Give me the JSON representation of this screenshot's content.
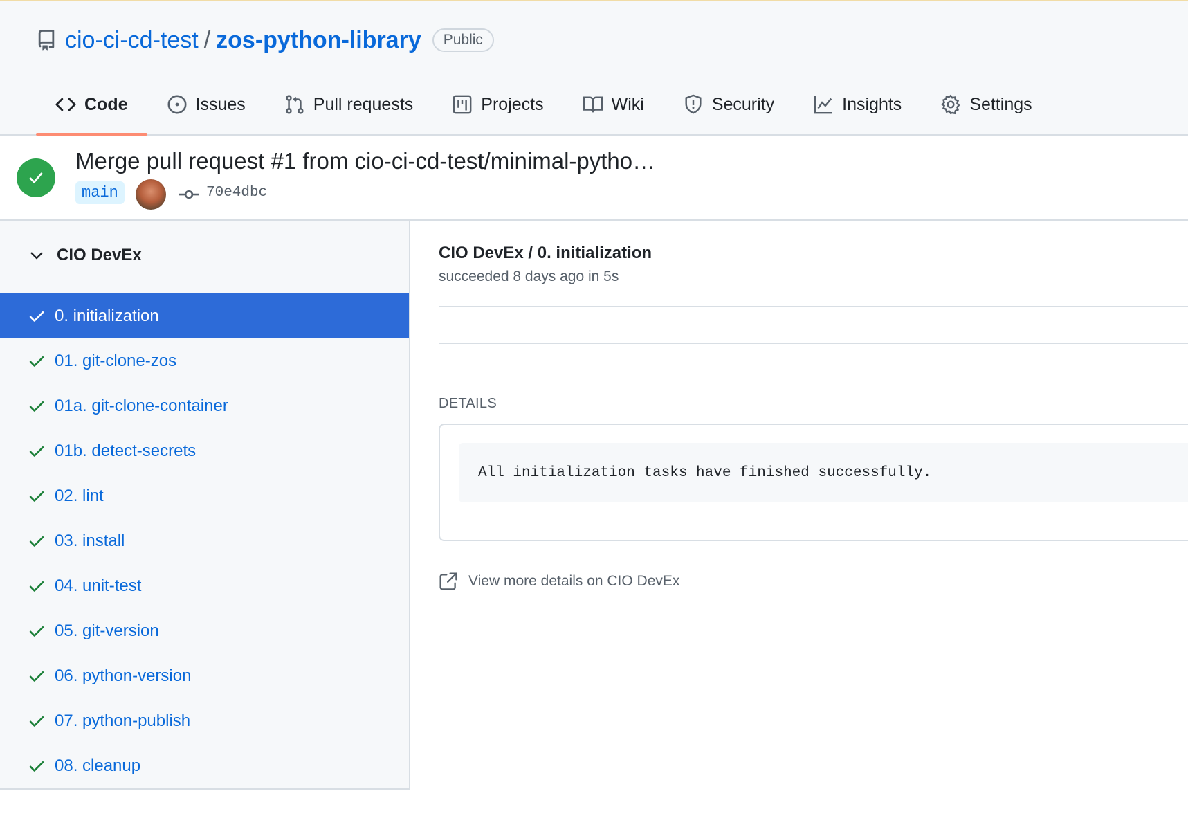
{
  "repo": {
    "owner": "cio-ci-cd-test",
    "separator": "/",
    "name": "zos-python-library",
    "visibility": "Public"
  },
  "tabs": [
    {
      "label": "Code",
      "icon": "code-icon",
      "active": true
    },
    {
      "label": "Issues",
      "icon": "issue-circle-icon"
    },
    {
      "label": "Pull requests",
      "icon": "pull-request-icon"
    },
    {
      "label": "Projects",
      "icon": "project-board-icon"
    },
    {
      "label": "Wiki",
      "icon": "book-icon"
    },
    {
      "label": "Security",
      "icon": "shield-icon"
    },
    {
      "label": "Insights",
      "icon": "graph-icon"
    },
    {
      "label": "Settings",
      "icon": "gear-icon"
    }
  ],
  "commit": {
    "title": "Merge pull request #1 from cio-ci-cd-test/minimal-pytho…",
    "branch": "main",
    "sha": "70e4dbc",
    "status": "success"
  },
  "sidebar": {
    "group": "CIO DevEx",
    "jobs": [
      {
        "label": "0. initialization",
        "selected": true
      },
      {
        "label": "01. git-clone-zos"
      },
      {
        "label": "01a. git-clone-container"
      },
      {
        "label": "01b. detect-secrets"
      },
      {
        "label": "02. lint"
      },
      {
        "label": "03. install"
      },
      {
        "label": "04. unit-test"
      },
      {
        "label": "05. git-version"
      },
      {
        "label": "06. python-version"
      },
      {
        "label": "07. python-publish"
      },
      {
        "label": "08. cleanup"
      }
    ]
  },
  "main": {
    "title": "CIO DevEx / 0. initialization",
    "subtitle": "succeeded 8 days ago in 5s",
    "details_label": "DETAILS",
    "details_text": "All initialization tasks have finished successfully.",
    "external_link": "View more details on CIO DevEx"
  },
  "colors": {
    "accent_blue": "#0969da",
    "success_green": "#2da44e",
    "selected_row": "#2d6bd8",
    "tab_underline": "#fd8c73"
  }
}
